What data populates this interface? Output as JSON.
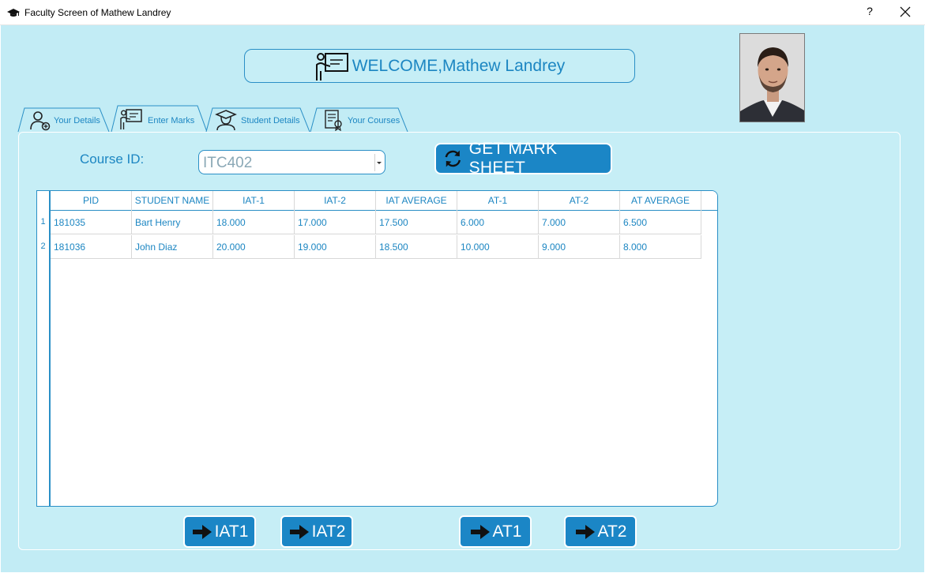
{
  "window": {
    "title": "Faculty Screen of Mathew Landrey",
    "help_label": "?"
  },
  "welcome": {
    "text": "WELCOME,Mathew Landrey"
  },
  "tabs": [
    {
      "label": "Your Details",
      "icon": "user-add-icon"
    },
    {
      "label": "Enter Marks",
      "icon": "teacher-board-icon"
    },
    {
      "label": "Student Details",
      "icon": "graduate-student-icon"
    },
    {
      "label": "Your Courses",
      "icon": "course-document-icon"
    }
  ],
  "active_tab": "Enter Marks",
  "course": {
    "label": "Course ID:",
    "selected": "ITC402"
  },
  "get_mark_sheet": {
    "label": "GET MARK SHEET",
    "icon": "refresh-icon"
  },
  "table": {
    "columns": [
      "PID",
      "STUDENT NAME",
      "IAT-1",
      "IAT-2",
      "IAT AVERAGE",
      "AT-1",
      "AT-2",
      "AT AVERAGE"
    ],
    "row_numbers": [
      "1",
      "2"
    ],
    "rows": [
      [
        "181035",
        "Bart Henry",
        "18.000",
        "17.000",
        "17.500",
        "6.000",
        "7.000",
        "6.500"
      ],
      [
        "181036",
        "John Diaz",
        "20.000",
        "19.000",
        "18.500",
        "10.000",
        "9.000",
        "8.000"
      ]
    ]
  },
  "actions": [
    {
      "label": "IAT1",
      "icon": "arrow-right-icon"
    },
    {
      "label": "IAT2",
      "icon": "arrow-right-icon"
    },
    {
      "label": "AT1",
      "icon": "arrow-right-icon"
    },
    {
      "label": "AT2",
      "icon": "arrow-right-icon"
    }
  ],
  "colors": {
    "background": "#c2ecf5",
    "accent": "#1b86c6",
    "text": "#1c86c2"
  }
}
